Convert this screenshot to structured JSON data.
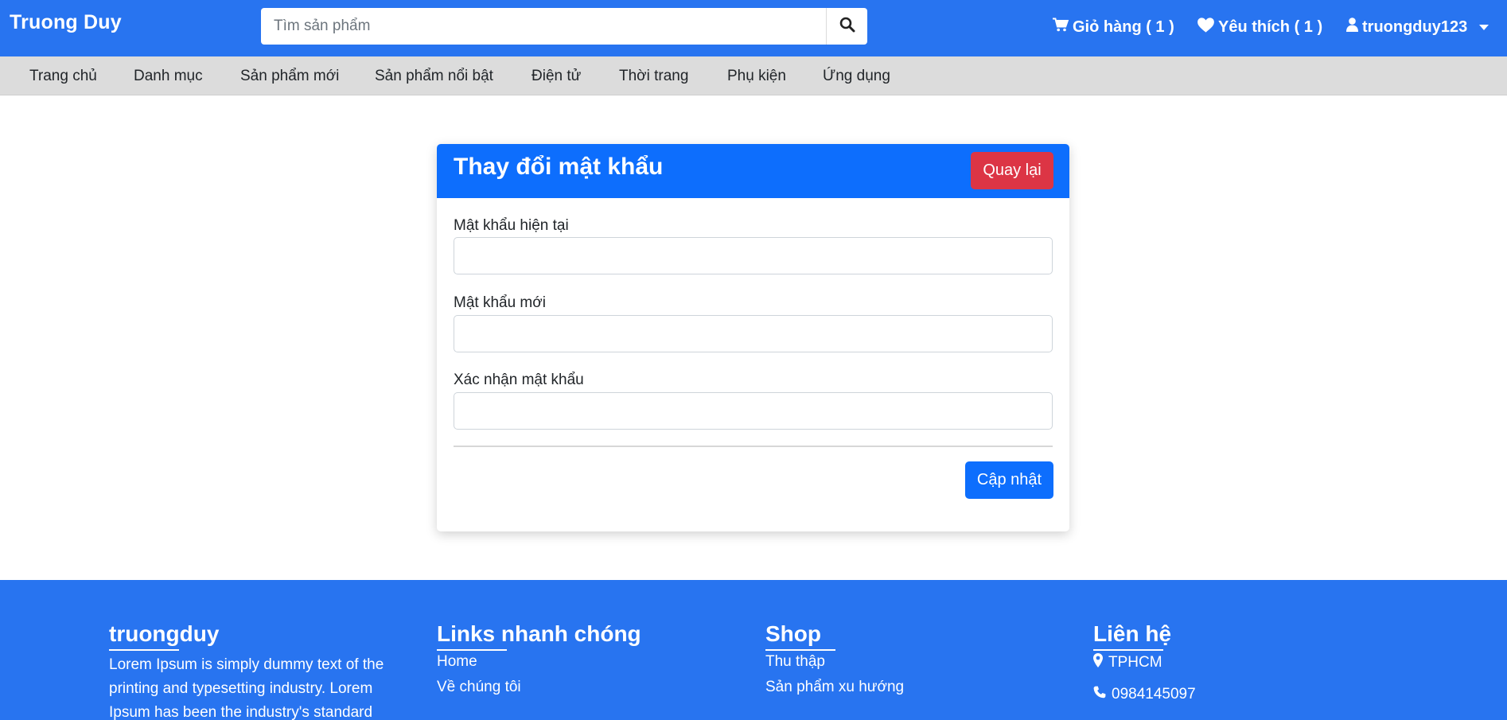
{
  "header": {
    "brand": "Truong Duy",
    "search": {
      "placeholder": "Tìm sản phẩm",
      "value": ""
    },
    "cart_label": "Giỏ hàng ( 1 )",
    "wishlist_label": "Yêu thích ( 1 )",
    "user_label": "truongduy123",
    "icons": [
      "search-icon",
      "cart-icon",
      "heart-icon",
      "user-icon",
      "caret-down-icon"
    ]
  },
  "categories": [
    "Trang chủ",
    "Danh mục",
    "Sản phẩm mới",
    "Sản phẩm nổi bật",
    "Điện tử",
    "Thời trang",
    "Phụ kiện",
    "Ứng dụng"
  ],
  "form": {
    "title": "Thay đổi mật khẩu",
    "back_label": "Quay lại",
    "current_password_label": "Mật khẩu hiện tại",
    "new_password_label": "Mật khẩu mới",
    "confirm_password_label": "Xác nhận mật khẩu",
    "current_password_value": "",
    "new_password_value": "",
    "confirm_password_value": "",
    "submit_label": "Cập nhật"
  },
  "footer": {
    "about": {
      "title": "truongduy",
      "text": "Lorem Ipsum is simply dummy text of the printing and typesetting industry. Lorem Ipsum has been the industry's standard"
    },
    "quick_links": {
      "title": "Links nhanh chóng",
      "items": [
        "Home",
        "Về chúng tôi"
      ]
    },
    "shop": {
      "title": "Shop",
      "items": [
        "Thu thập",
        "Sản phẩm xu hướng"
      ]
    },
    "contact": {
      "title": "Liên hệ",
      "address": "TPHCM",
      "phone": "0984145097"
    }
  },
  "colors": {
    "primary": "#2874f0",
    "button_primary": "#0d6efd",
    "button_danger": "#dc3545",
    "category_bar": "#dcdcdc"
  }
}
